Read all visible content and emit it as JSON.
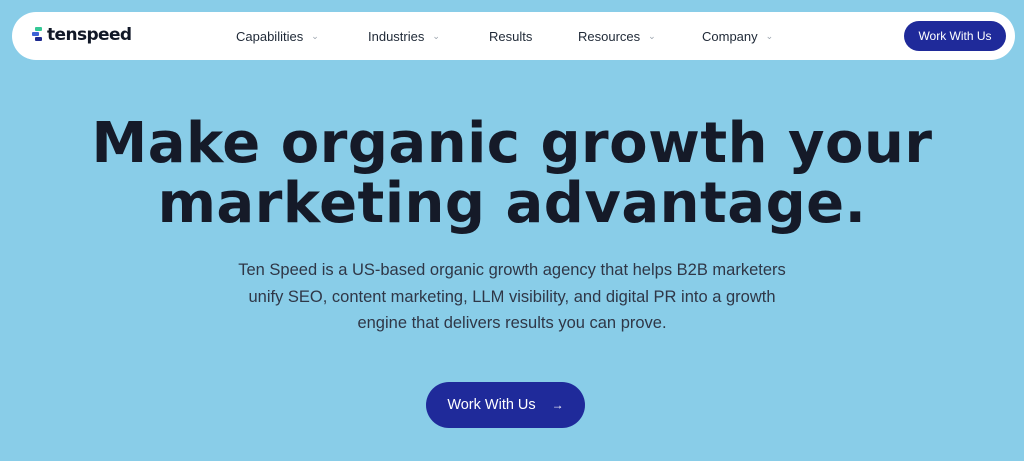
{
  "brand": {
    "name": "tenspeed",
    "mark_colors": [
      "#35c896",
      "#3d63d6",
      "#1e2a8f"
    ]
  },
  "nav": {
    "items": [
      {
        "label": "Capabilities",
        "has_dropdown": true,
        "icon": "chevron-down-icon"
      },
      {
        "label": "Industries",
        "has_dropdown": true,
        "icon": "chevron-down-icon"
      },
      {
        "label": "Results",
        "has_dropdown": false
      },
      {
        "label": "Resources",
        "has_dropdown": true,
        "icon": "chevron-down-icon"
      },
      {
        "label": "Company",
        "has_dropdown": true,
        "icon": "chevron-down-icon"
      }
    ],
    "cta_label": "Work With Us"
  },
  "hero": {
    "headline_line1": "Make organic growth your",
    "headline_line2": "marketing advantage.",
    "subtext_line1": "Ten Speed is a US-based organic growth agency that helps B2B marketers",
    "subtext_line2": "unify SEO, content marketing, LLM visibility, and digital PR into a growth",
    "subtext_line3": "engine that delivers results you can prove.",
    "cta_label": "Work With Us",
    "cta_icon": "arrow-right-icon"
  },
  "colors": {
    "background": "#89CDE8",
    "accent": "#1f2a9a",
    "nav_bg": "#ffffff",
    "text_dark": "#151a28"
  }
}
